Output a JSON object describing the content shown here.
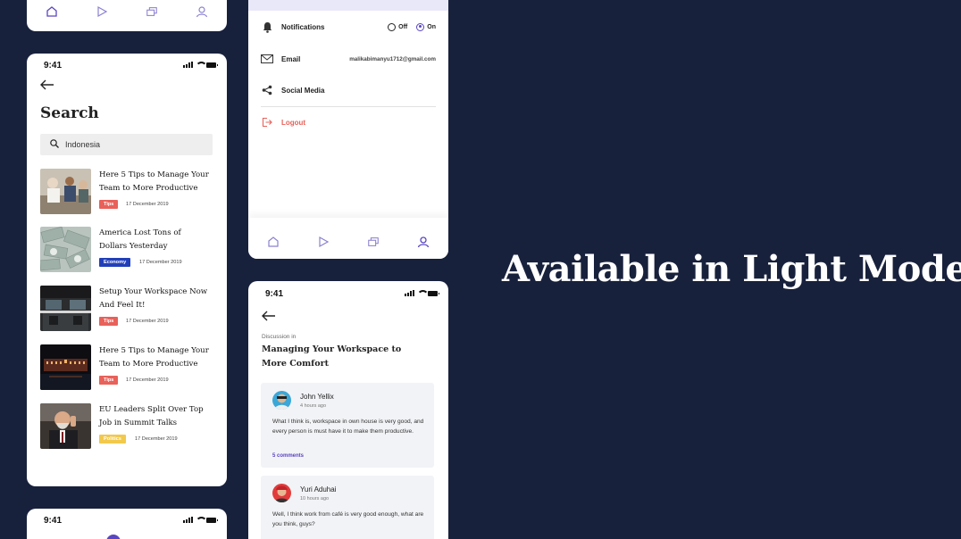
{
  "headline": "Available in Light Mode",
  "status_time": "9:41",
  "search_screen": {
    "title": "Search",
    "query": "Indonesia",
    "articles": [
      {
        "title": "Here 5 Tips to Manage Your Team to More Productive",
        "tag": "Tips",
        "tag_color": "#e8615a",
        "date": "17 December 2019"
      },
      {
        "title": "America Lost Tons of Dollars Yesterday",
        "tag": "Economy",
        "tag_color": "#2140b8",
        "date": "17 December 2019"
      },
      {
        "title": "Setup Your Workspace Now And Feel It!",
        "tag": "Tips",
        "tag_color": "#e8615a",
        "date": "17 December 2019"
      },
      {
        "title": "Here 5 Tips to Manage Your Team to More Productive",
        "tag": "Tips",
        "tag_color": "#e8615a",
        "date": "17 December 2019"
      },
      {
        "title": "EU Leaders Split Over Top Job in Summit Talks",
        "tag": "Politics",
        "tag_color": "#f2c94c",
        "date": "17 December 2019"
      }
    ]
  },
  "settings_screen": {
    "notifications_label": "Notifications",
    "off_label": "Off",
    "on_label": "On",
    "email_label": "Email",
    "email_value": "malikabimanyu1712@gmail.com",
    "social_label": "Social Media",
    "logout_label": "Logout"
  },
  "discussion_screen": {
    "kicker": "Discussion in",
    "title": "Managing Your Workspace to More Comfort",
    "comments": [
      {
        "name": "John Yellix",
        "time": "4 hours ago",
        "text": "What I think is, workspace in own house is very good, and every person is must have it to make them productive.",
        "link": "5 comments"
      },
      {
        "name": "Yuri Aduhai",
        "time": "10 hours ago",
        "text": "Well, I think work from café is very good enough, what are you think, guys?",
        "link": ""
      }
    ]
  },
  "colors": {
    "accent": "#5a45c2",
    "background": "#18213c",
    "logout": "#e8615a"
  },
  "nav_icons": [
    "home-icon",
    "play-icon",
    "collections-icon",
    "profile-icon"
  ]
}
